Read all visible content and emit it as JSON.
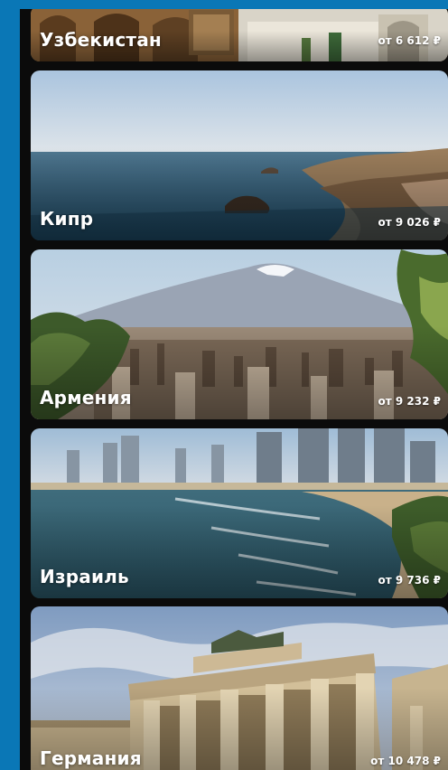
{
  "destinations": [
    {
      "name": "Узбекистан",
      "price": "от 6 612 ₽"
    },
    {
      "name": "Кипр",
      "price": "от 9 026 ₽"
    },
    {
      "name": "Армения",
      "price": "от 9 232 ₽"
    },
    {
      "name": "Израиль",
      "price": "от 9 736 ₽"
    },
    {
      "name": "Германия",
      "price": "от 10 478 ₽"
    }
  ]
}
